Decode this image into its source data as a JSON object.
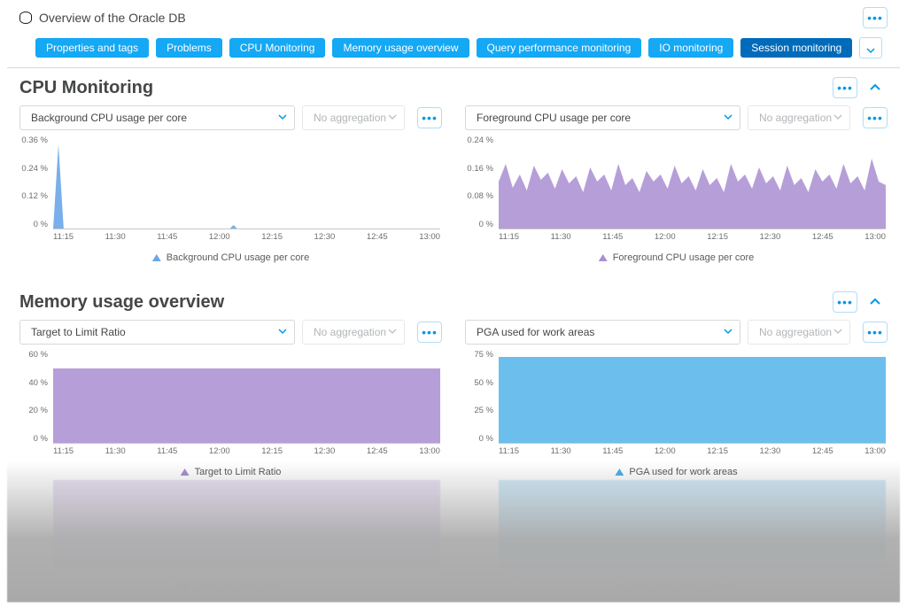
{
  "header": {
    "title": "Overview of the Oracle DB"
  },
  "tabs": [
    {
      "label": "Properties and tags",
      "active": false
    },
    {
      "label": "Problems",
      "active": false
    },
    {
      "label": "CPU Monitoring",
      "active": false
    },
    {
      "label": "Memory usage overview",
      "active": false
    },
    {
      "label": "Query performance monitoring",
      "active": false
    },
    {
      "label": "IO monitoring",
      "active": false
    },
    {
      "label": "Session monitoring",
      "active": true
    }
  ],
  "sections": {
    "cpu": {
      "title": "CPU Monitoring",
      "charts": {
        "left": {
          "selector_label": "Background CPU usage per core",
          "agg_label": "No aggregation",
          "legend": "Background CPU usage per core",
          "y_ticks": [
            "0.36 %",
            "0.24 %",
            "0.12 %",
            "0 %"
          ],
          "x_ticks": [
            "11:15",
            "11:30",
            "11:45",
            "12:00",
            "12:15",
            "12:30",
            "12:45",
            "13:00"
          ]
        },
        "right": {
          "selector_label": "Foreground CPU usage per core",
          "agg_label": "No aggregation",
          "legend": "Foreground CPU usage per core",
          "y_ticks": [
            "0.24 %",
            "0.16 %",
            "0.08 %",
            "0 %"
          ],
          "x_ticks": [
            "11:15",
            "11:30",
            "11:45",
            "12:00",
            "12:15",
            "12:30",
            "12:45",
            "13:00"
          ]
        }
      }
    },
    "memory": {
      "title": "Memory usage overview",
      "charts": {
        "left": {
          "selector_label": "Target to Limit Ratio",
          "agg_label": "No aggregation",
          "legend": "Target to Limit Ratio",
          "y_ticks": [
            "60 %",
            "40 %",
            "20 %",
            "0 %"
          ],
          "x_ticks": [
            "11:15",
            "11:30",
            "11:45",
            "12:00",
            "12:15",
            "12:30",
            "12:45",
            "13:00"
          ]
        },
        "right": {
          "selector_label": "PGA used for work areas",
          "agg_label": "No aggregation",
          "legend": "PGA used for work areas",
          "y_ticks": [
            "75 %",
            "50 %",
            "25 %",
            "0 %"
          ],
          "x_ticks": [
            "11:15",
            "11:30",
            "11:45",
            "12:00",
            "12:15",
            "12:30",
            "12:45",
            "13:00"
          ]
        }
      }
    }
  },
  "colors": {
    "blue": "#6aa6e8",
    "purple": "#a98ed1",
    "lightblue": "#5cb8ea",
    "accent": "#0098e6"
  },
  "chart_data": [
    {
      "type": "area",
      "title": "Background CPU usage per core",
      "xlabel": "",
      "ylabel": "%",
      "ylim": [
        0,
        0.36
      ],
      "x": [
        "11:00",
        "11:02",
        "11:04",
        "11:55",
        "13:00"
      ],
      "series": [
        {
          "name": "Background CPU usage per core",
          "values": [
            0,
            0.34,
            0,
            0.02,
            0
          ],
          "color": "#6aa6e8"
        }
      ]
    },
    {
      "type": "area",
      "title": "Foreground CPU usage per core",
      "xlabel": "",
      "ylabel": "%",
      "ylim": [
        0,
        0.24
      ],
      "x": [
        "11:00",
        "11:05",
        "11:10",
        "11:15",
        "11:20",
        "11:25",
        "11:30",
        "11:35",
        "11:40",
        "11:45",
        "11:50",
        "11:55",
        "12:00",
        "12:05",
        "12:10",
        "12:15",
        "12:20",
        "12:25",
        "12:30",
        "12:35",
        "12:40",
        "12:45",
        "12:50",
        "12:55",
        "13:00"
      ],
      "series": [
        {
          "name": "Foreground CPU usage per core",
          "values": [
            0.12,
            0.17,
            0.11,
            0.15,
            0.1,
            0.16,
            0.13,
            0.11,
            0.15,
            0.12,
            0.17,
            0.1,
            0.14,
            0.11,
            0.16,
            0.13,
            0.1,
            0.15,
            0.12,
            0.17,
            0.11,
            0.14,
            0.1,
            0.18,
            0.12
          ],
          "color": "#a98ed1"
        }
      ]
    },
    {
      "type": "area",
      "title": "Target to Limit Ratio",
      "xlabel": "",
      "ylabel": "%",
      "ylim": [
        0,
        60
      ],
      "x": [
        "11:00",
        "13:00"
      ],
      "series": [
        {
          "name": "Target to Limit Ratio",
          "values": [
            50,
            50
          ],
          "color": "#a98ed1"
        }
      ]
    },
    {
      "type": "area",
      "title": "PGA used for work areas",
      "xlabel": "",
      "ylabel": "%",
      "ylim": [
        0,
        75
      ],
      "x": [
        "11:00",
        "13:00"
      ],
      "series": [
        {
          "name": "PGA used for work areas",
          "values": [
            72,
            72
          ],
          "color": "#5cb8ea"
        }
      ]
    }
  ]
}
